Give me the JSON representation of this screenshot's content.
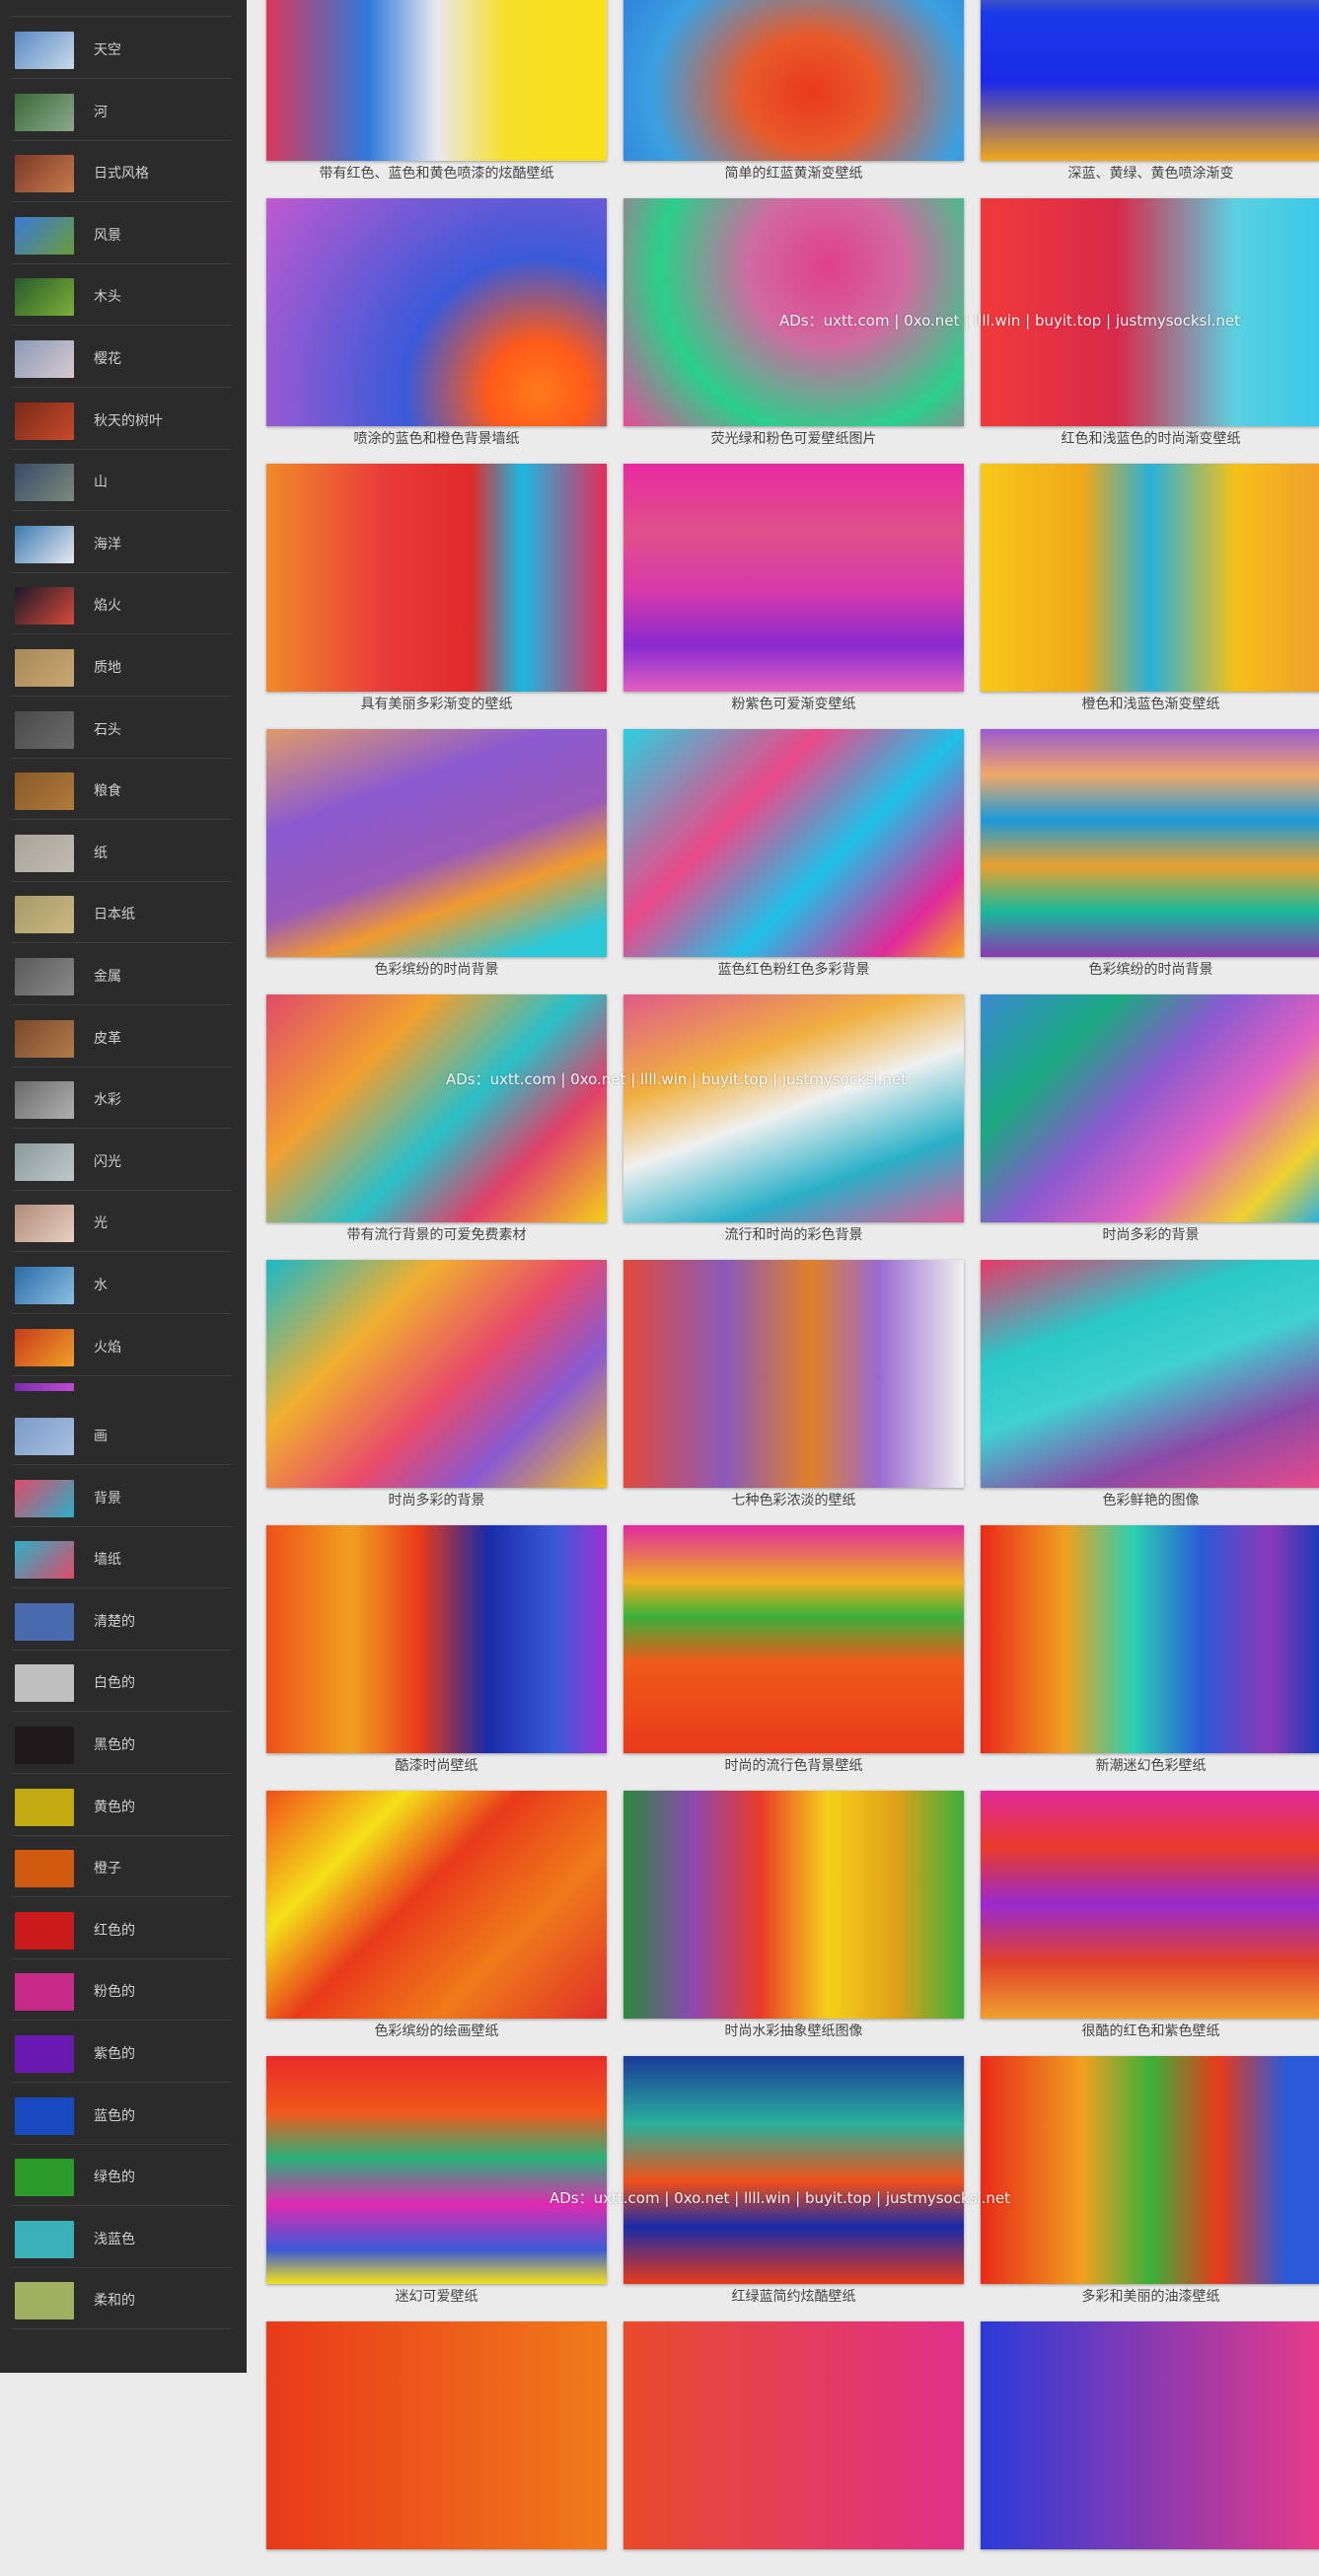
{
  "sidebar": {
    "categories": [
      {
        "label": "天空",
        "colors": [
          "#5a8ac8",
          "#c8d8e8"
        ]
      },
      {
        "label": "河",
        "colors": [
          "#3a6a3a",
          "#8aa88a"
        ]
      },
      {
        "label": "日式风格",
        "colors": [
          "#7a3a2a",
          "#c87a4a"
        ]
      },
      {
        "label": "风景",
        "colors": [
          "#3a7ad8",
          "#6a9a3a"
        ]
      },
      {
        "label": "木头",
        "colors": [
          "#2a5a2a",
          "#7ab03a"
        ]
      },
      {
        "label": "樱花",
        "colors": [
          "#8a9ab8",
          "#d8c8d0"
        ]
      },
      {
        "label": "秋天的树叶",
        "colors": [
          "#7a2a1a",
          "#c84a2a"
        ]
      },
      {
        "label": "山",
        "colors": [
          "#3a4a6a",
          "#7a8a7a"
        ]
      },
      {
        "label": "海洋",
        "colors": [
          "#3a7ab0",
          "#e8e8f0"
        ]
      },
      {
        "label": "焰火",
        "colors": [
          "#1a1a2a",
          "#d84a3a"
        ]
      },
      {
        "label": "质地",
        "colors": [
          "#a88a5a",
          "#c8a870"
        ]
      },
      {
        "label": "石头",
        "colors": [
          "#4a4a4a",
          "#6a6a6a"
        ]
      },
      {
        "label": "粮食",
        "colors": [
          "#8a5a2a",
          "#b07a3a"
        ]
      },
      {
        "label": "纸",
        "colors": [
          "#a8a49a",
          "#c0bcb0"
        ]
      },
      {
        "label": "日本纸",
        "colors": [
          "#a89a6a",
          "#c8b880"
        ]
      },
      {
        "label": "金属",
        "colors": [
          "#5a5a5a",
          "#8a8a8a"
        ]
      },
      {
        "label": "皮革",
        "colors": [
          "#7a4a2a",
          "#b07a4a"
        ]
      },
      {
        "label": "水彩",
        "colors": [
          "#6a6a6a",
          "#b0b0b0"
        ]
      },
      {
        "label": "闪光",
        "colors": [
          "#8a9a9a",
          "#c0c8c8"
        ]
      },
      {
        "label": "光",
        "colors": [
          "#b08a7a",
          "#e8d0c0"
        ]
      },
      {
        "label": "水",
        "colors": [
          "#2a6aa8",
          "#8ac0e0"
        ]
      },
      {
        "label": "火焰",
        "colors": [
          "#c83a1a",
          "#f0a02a"
        ]
      },
      {
        "label": "画",
        "colors": [
          "#7a9ac8",
          "#a8c0e0"
        ]
      },
      {
        "label": "背景",
        "colors": [
          "#e04a6a",
          "#2ab0c8"
        ]
      },
      {
        "label": "墙纸",
        "colors": [
          "#2ab0c8",
          "#e04a6a"
        ]
      },
      {
        "label": "清楚的",
        "colors": [
          "#4a6ab0",
          "#4a6ab0"
        ]
      },
      {
        "label": "白色的",
        "colors": [
          "#c0c0c0",
          "#c0c0c0"
        ]
      },
      {
        "label": "黑色的",
        "colors": [
          "#1e1a1c",
          "#1e1a1c"
        ]
      },
      {
        "label": "黄色的",
        "colors": [
          "#c0aa10",
          "#c0aa10"
        ]
      },
      {
        "label": "橙子",
        "colors": [
          "#d05a10",
          "#d05a10"
        ]
      },
      {
        "label": "红色的",
        "colors": [
          "#c81a1a",
          "#c81a1a"
        ]
      },
      {
        "label": "粉色的",
        "colors": [
          "#c82a8a",
          "#c82a8a"
        ]
      },
      {
        "label": "紫色的",
        "colors": [
          "#6a1ab0",
          "#6a1ab0"
        ]
      },
      {
        "label": "蓝色的",
        "colors": [
          "#1a4ac0",
          "#1a4ac0"
        ]
      },
      {
        "label": "绿色的",
        "colors": [
          "#2a9a2a",
          "#2a9a2a"
        ]
      },
      {
        "label": "浅蓝色",
        "colors": [
          "#3ab0b8",
          "#3ab0b8"
        ]
      },
      {
        "label": "柔和的",
        "colors": [
          "#a0b060",
          "#a0b060"
        ]
      }
    ]
  },
  "gallery": {
    "rows": [
      [
        "带有红色、蓝色和黄色喷漆的炫酷壁纸",
        "简单的红蓝黄渐变壁纸",
        "深蓝、黄绿、黄色喷涂渐变"
      ],
      [
        "喷涂的蓝色和橙色背景墙纸",
        "荧光绿和粉色可爱壁纸图片",
        "红色和浅蓝色的时尚渐变壁纸"
      ],
      [
        "具有美丽多彩渐变的壁纸",
        "粉紫色可爱渐变壁纸",
        "橙色和浅蓝色渐变壁纸"
      ],
      [
        "色彩缤纷的时尚背景",
        "蓝色红色粉红色多彩背景",
        "色彩缤纷的时尚背景"
      ],
      [
        "带有流行背景的可爱免费素材",
        "流行和时尚的彩色背景",
        "时尚多彩的背景"
      ],
      [
        "时尚多彩的背景",
        "七种色彩浓淡的壁纸",
        "色彩鲜艳的图像"
      ],
      [
        "酷漆时尚壁纸",
        "时尚的流行色背景壁纸",
        "新潮迷幻色彩壁纸"
      ],
      [
        "色彩缤纷的绘画壁纸",
        "时尚水彩抽象壁纸图像",
        "很酷的红色和紫色壁纸"
      ],
      [
        "迷幻可爱壁纸",
        "红绿蓝简约炫酷壁纸",
        "多彩和美丽的油漆壁纸"
      ],
      [
        "",
        "",
        ""
      ]
    ]
  },
  "ads": {
    "text": "ADs：uxtt.com | 0xo.net | llll.win | buyit.top | justmysocksl.net"
  }
}
